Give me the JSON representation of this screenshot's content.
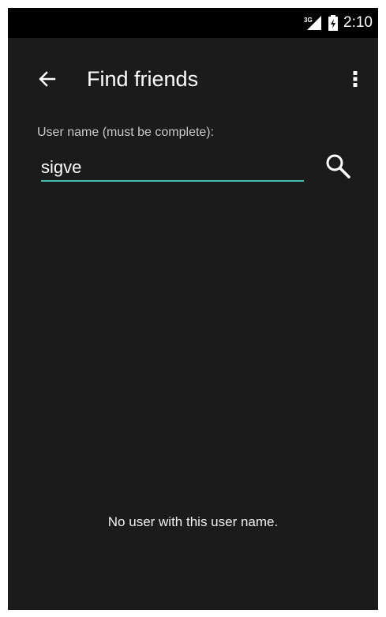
{
  "status_bar": {
    "network_type": "3G",
    "time": "2:10",
    "icons": [
      "signal-icon",
      "battery-icon"
    ]
  },
  "app_bar": {
    "title": "Find friends",
    "icons": [
      "back-arrow-icon",
      "overflow-menu-icon"
    ]
  },
  "search_form": {
    "label": "User name (must be complete):",
    "value": "sigve",
    "accent_color": "#44bdb0",
    "button_icon": "search-icon"
  },
  "result": {
    "message": "No user with this user name."
  }
}
